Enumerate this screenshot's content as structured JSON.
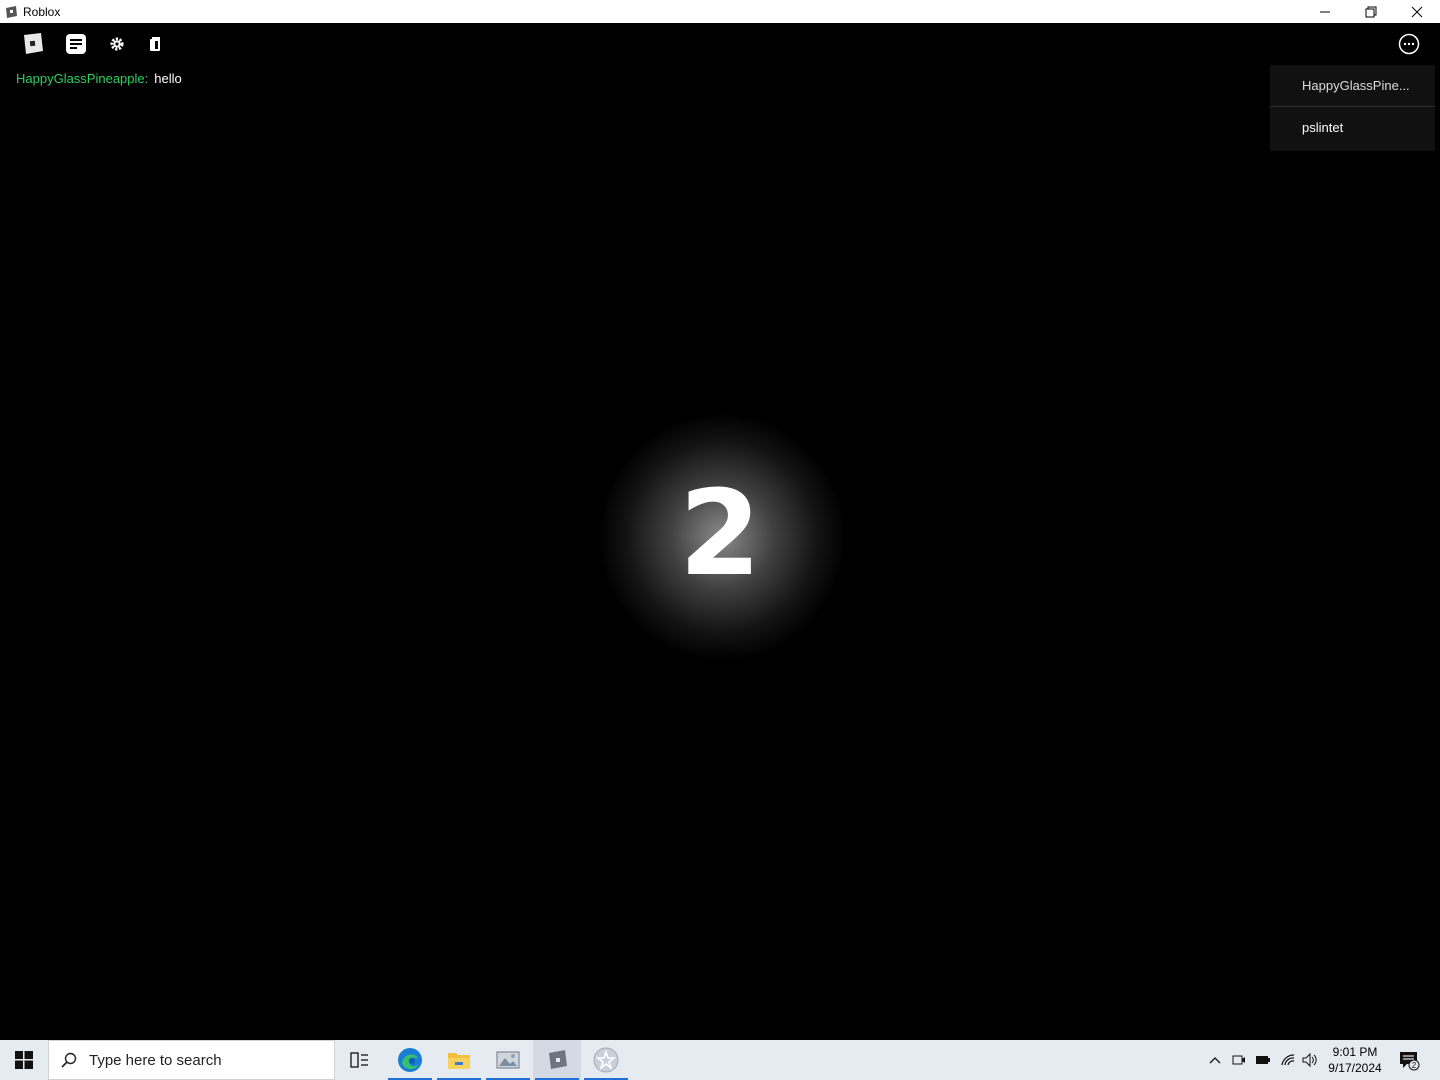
{
  "window": {
    "title": "Roblox"
  },
  "chat": {
    "name": "HappyGlassPineapple:",
    "message": "hello"
  },
  "players": [
    {
      "name": "HappyGlassPine..."
    },
    {
      "name": "pslintet"
    }
  ],
  "countdown": "2",
  "taskbar": {
    "search_placeholder": "Type here to search",
    "time": "9:01 PM",
    "date": "9/17/2024",
    "notification_count": "2"
  },
  "colors": {
    "chat_name": "#2ed05b",
    "taskbar_bg": "#e6ebf2",
    "active_indicator": "#1f6fd6"
  }
}
